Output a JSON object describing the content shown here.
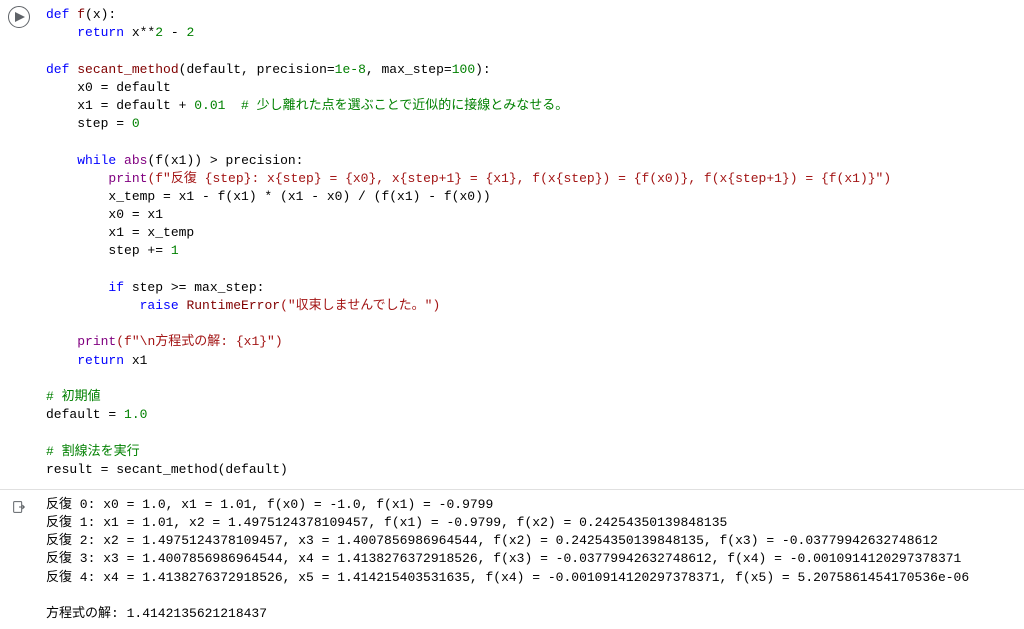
{
  "code": {
    "line1_def": "def",
    "line1_fn": "f",
    "line1_rest": "(x):",
    "line2_kw": "return",
    "line2_expr": " x**",
    "line2_num1": "2",
    "line2_m": " - ",
    "line2_num2": "2",
    "line4_def": "def",
    "line4_fn": "secant_method",
    "line4_sig_a": "(default, precision=",
    "line4_num1": "1e-8",
    "line4_sig_b": ", max_step=",
    "line4_num2": "100",
    "line4_sig_c": "):",
    "line5": "    x0 = default",
    "line6_a": "    x1 = default + ",
    "line6_num": "0.01",
    "line6_cmt": "  # 少し離れた点を選ぶことで近似的に接線とみなせる。",
    "line7_a": "    step = ",
    "line7_num": "0",
    "line9_kw": "while",
    "line9_abs": "abs",
    "line9_rest": "(f(x1)) > precision:",
    "line10_print": "print",
    "line10_str": "(f\"反復 {step}: x{step} = {x0}, x{step+1} = {x1}, f(x{step}) = {f(x0)}, f(x{step+1}) = {f(x1)}\")",
    "line11": "        x_temp = x1 - f(x1) * (x1 - x0) / (f(x1) - f(x0))",
    "line12": "        x0 = x1",
    "line13": "        x1 = x_temp",
    "line14_a": "        step += ",
    "line14_num": "1",
    "line16_kw": "if",
    "line16_rest": " step >= max_step:",
    "line17_kw": "raise",
    "line17_err": "RuntimeError",
    "line17_str": "(\"収束しませんでした。\")",
    "line19_print": "print",
    "line19_str": "(f\"\\n方程式の解: {x1}\")",
    "line20_kw": "return",
    "line20_rest": " x1",
    "line22_cmt": "# 初期値",
    "line23_a": "default = ",
    "line23_num": "1.0",
    "line25_cmt": "# 割線法を実行",
    "line26": "result = secant_method(default)"
  },
  "output": {
    "l1": "反復 0: x0 = 1.0, x1 = 1.01, f(x0) = -1.0, f(x1) = -0.9799",
    "l2": "反復 1: x1 = 1.01, x2 = 1.4975124378109457, f(x1) = -0.9799, f(x2) = 0.24254350139848135",
    "l3": "反復 2: x2 = 1.4975124378109457, x3 = 1.4007856986964544, f(x2) = 0.24254350139848135, f(x3) = -0.03779942632748612",
    "l4": "反復 3: x3 = 1.4007856986964544, x4 = 1.4138276372918526, f(x3) = -0.03779942632748612, f(x4) = -0.0010914120297378371",
    "l5": "反復 4: x4 = 1.4138276372918526, x5 = 1.414215403531635, f(x4) = -0.0010914120297378371, f(x5) = 5.2075861454170536e-06",
    "l6": "",
    "l7": "方程式の解: 1.4142135621218437"
  }
}
